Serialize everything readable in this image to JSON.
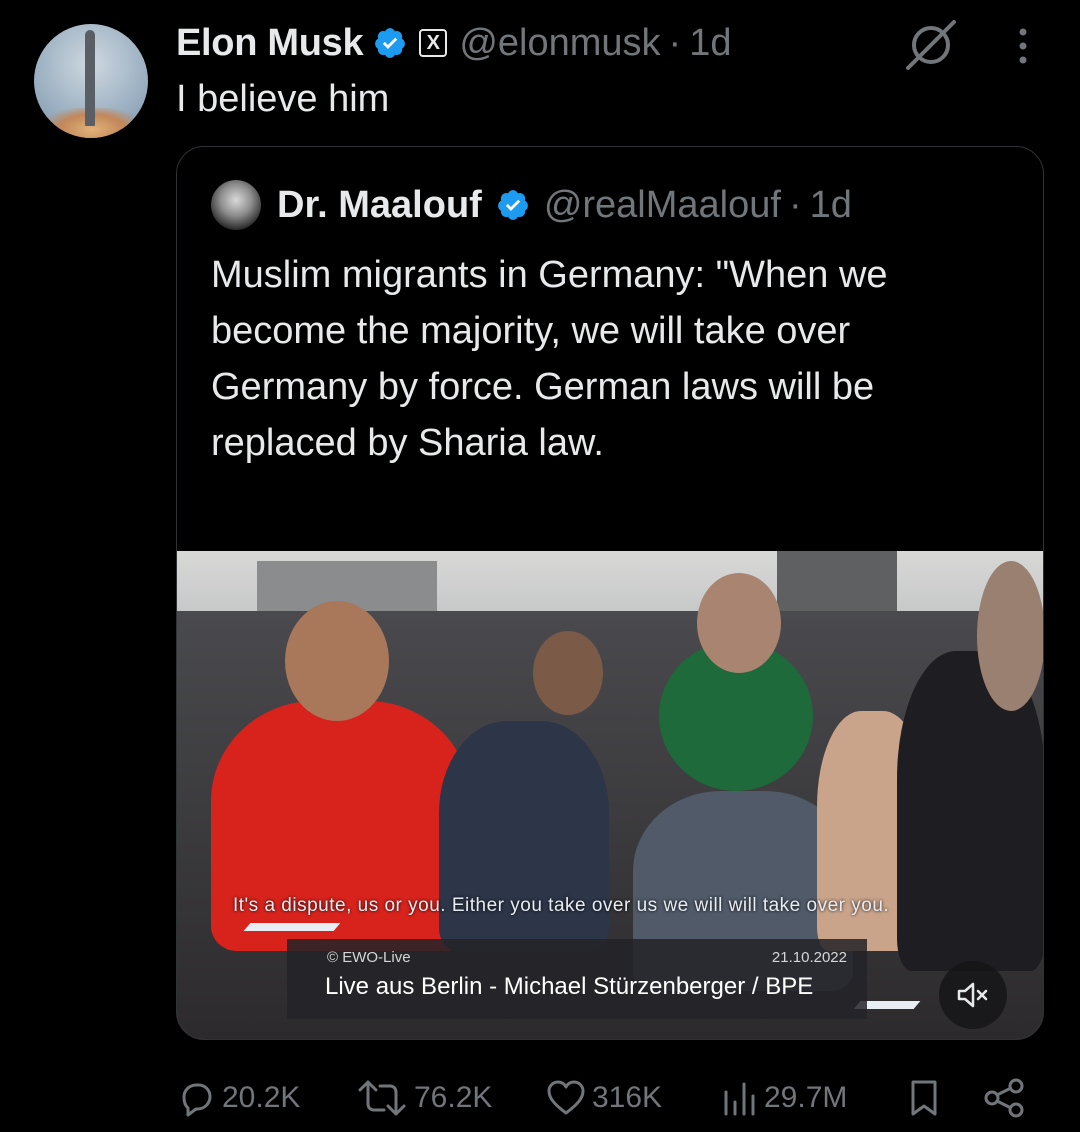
{
  "post": {
    "author_name": "Elon Musk",
    "handle": "@elonmusk",
    "separator": "·",
    "time": "1d",
    "text": "I believe him",
    "verified_color": "#1d9bf0",
    "badge_letter": "X"
  },
  "quoted": {
    "author_name": "Dr. Maalouf",
    "handle": "@realMaalouf",
    "separator": "·",
    "time": "1d",
    "text_lines": [
      "Muslim migrants in Germany: \"When we",
      "become the majority, we will take over",
      "Germany by force. German laws will be",
      "replaced by Sharia law."
    ],
    "ellipsis": "...",
    "video": {
      "subtitle": "It's a dispute, us or you. Either you take over us we will will take over you.",
      "source": "© EWO-Live",
      "date": "21.10.2022",
      "title": "Live aus Berlin - Michael Stürzenberger / BPE"
    }
  },
  "actions": {
    "replies": "20.2K",
    "reposts": "76.2K",
    "likes": "316K",
    "views": "29.7M"
  },
  "icons": {
    "grok": "grok-icon",
    "more": "more-icon",
    "reply": "reply-icon",
    "repost": "repost-icon",
    "like": "heart-icon",
    "views": "views-icon",
    "bookmark": "bookmark-icon",
    "share": "share-icon",
    "mute": "mute-icon"
  },
  "colors": {
    "background": "#000000",
    "text": "#e7e9ea",
    "muted_text": "#71767b",
    "card_border": "#2f3336",
    "verified": "#1d9bf0"
  }
}
